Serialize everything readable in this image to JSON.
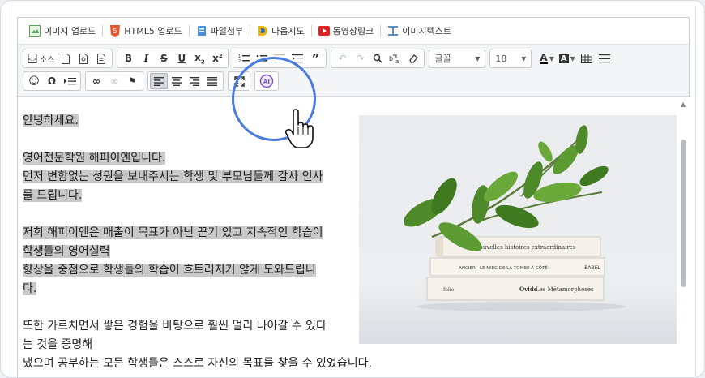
{
  "attachbar": {
    "items": [
      {
        "label": "이미지 업로드",
        "icon": "image-upload-icon",
        "color": "#5aa35a"
      },
      {
        "label": "HTML5 업로드",
        "icon": "html5-icon",
        "color": "#e4572e"
      },
      {
        "label": "파일첨부",
        "icon": "file-attach-icon",
        "color": "#4a90d9"
      },
      {
        "label": "다음지도",
        "icon": "daum-map-icon",
        "color": "#f2b400"
      },
      {
        "label": "동영상링크",
        "icon": "video-link-icon",
        "color": "#e02020"
      },
      {
        "label": "이미지텍스트",
        "icon": "image-text-icon",
        "color": "#5b8fc9"
      }
    ]
  },
  "toolbar": {
    "source_label": "소스",
    "font_placeholder": "글꼴",
    "font_size": "18",
    "active_align": "align-left"
  },
  "content": {
    "lines": [
      {
        "text": "안녕하세요.",
        "highlighted": true
      },
      {
        "text": "",
        "highlighted": false
      },
      {
        "text": "영어전문학원 해피이엔입니다.",
        "highlighted": true
      },
      {
        "text": "먼저 변함없는 성원을 보내주시는 학생 및 부모님들께 감사 인사",
        "highlighted": true
      },
      {
        "text": "를 드립니다.",
        "highlighted": true
      },
      {
        "text": "",
        "highlighted": false
      },
      {
        "text": "저희 해피이엔은 매출이 목표가 아닌 끈기 있고 지속적인 학습이",
        "highlighted": true
      },
      {
        "text": "학생들의 영어실력",
        "highlighted": true
      },
      {
        "text": "향상을 중점으로 학생들의 학습이 흐트러지기 않게 도와드립니",
        "highlighted": true
      },
      {
        "text": "다.",
        "highlighted": true
      },
      {
        "text": "",
        "highlighted": false
      },
      {
        "text": "또한 가르치면서 쌓은 경험을 바탕으로 훨씬 멀리 나아갈 수 있다",
        "highlighted": false
      },
      {
        "text": "는 것을 증명해",
        "highlighted": false
      },
      {
        "text": "냈으며 공부하는 모든 학생들은 스스로 자신의 목표를 찾을 수 있었습니다.",
        "highlighted": false
      }
    ],
    "books": [
      {
        "title": "Nouvelles histoires extraordinaires",
        "author": ""
      },
      {
        "title": "ANCIER · LE MIEC DE LA TOMBE À CÔTÉ",
        "author": "BABEL"
      },
      {
        "title": "Les Métamorphoses",
        "author": "Ovide",
        "publisher": "folio"
      }
    ]
  },
  "colors": {
    "accent_ring": "#4a7be0",
    "highlight_bg": "#c9c9c9",
    "ai_icon": "#7a4fd6"
  }
}
